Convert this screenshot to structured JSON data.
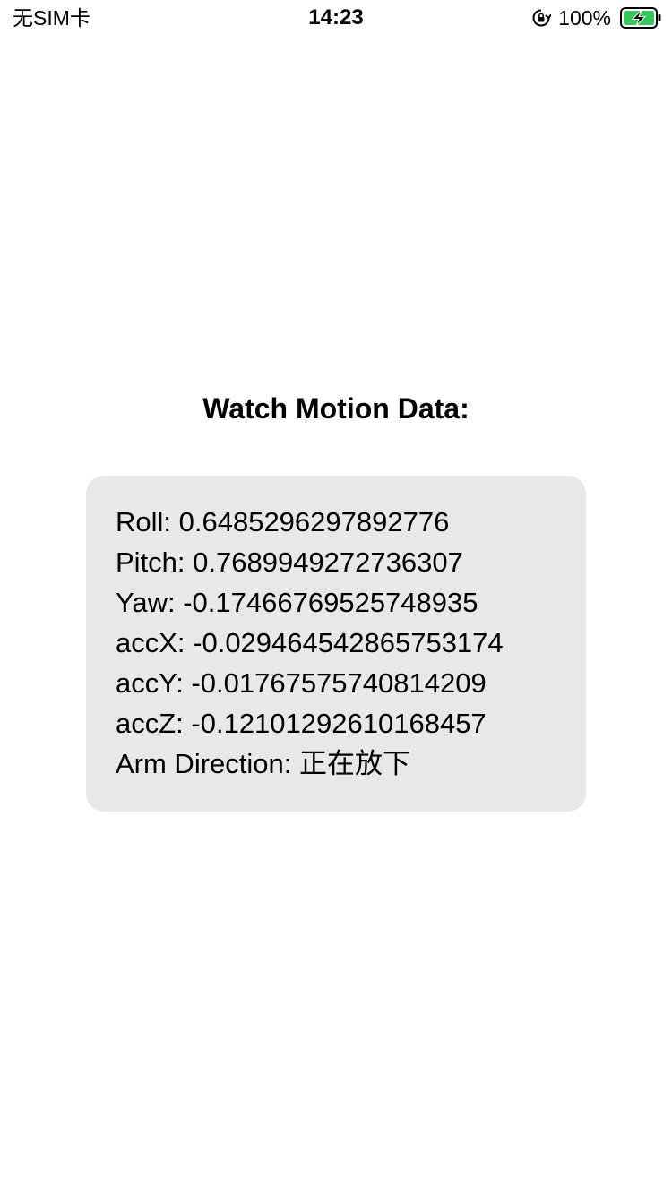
{
  "status_bar": {
    "carrier": "无SIM卡",
    "time": "14:23",
    "battery_percent": "100%",
    "lock_icon": "orientation-lock-icon",
    "battery_icon": "battery-charging-icon",
    "battery_color": "#34c759"
  },
  "title": "Watch Motion Data:",
  "motion": {
    "roll": "Roll: 0.6485296297892776",
    "pitch": "Pitch: 0.7689949272736307",
    "yaw": "Yaw: -0.17466769525748935",
    "accx": "accX: -0.029464542865753174",
    "accy": "accY: -0.01767575740814209",
    "accz": "accZ: -0.12101292610168457",
    "arm_direction": "Arm Direction: 正在放下"
  },
  "colors": {
    "card_background": "#e8e8e8",
    "text": "#000000"
  }
}
